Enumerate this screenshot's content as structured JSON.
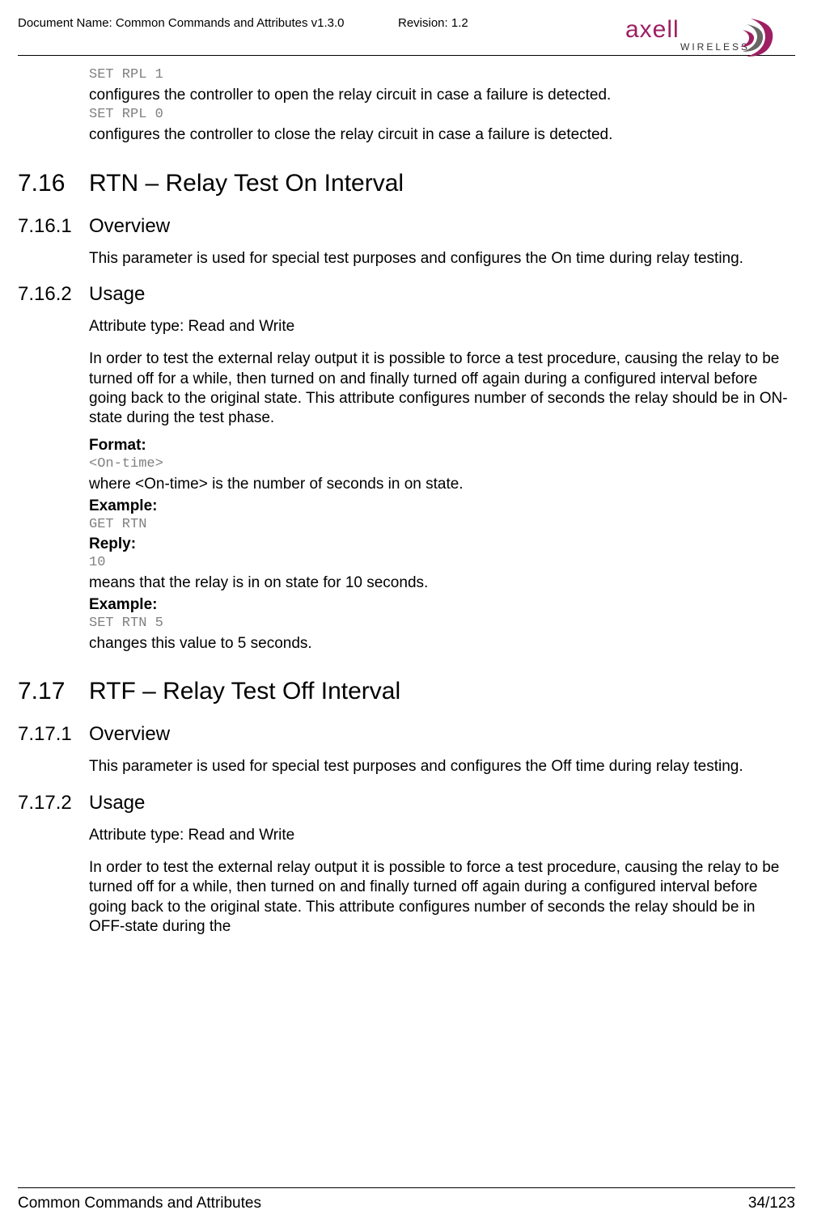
{
  "header": {
    "doc_name_label": "Document Name: Common Commands and Attributes v1.3.0",
    "revision_label": "Revision: 1.2",
    "logo_brand": "axell",
    "logo_sub": "WIRELESS"
  },
  "intro": {
    "code1": "SET RPL 1",
    "text1": "configures the controller to open the relay circuit in case a failure is detected.",
    "code2": "SET RPL 0",
    "text2": "configures the controller to close the relay circuit in case a failure is detected."
  },
  "s716": {
    "num": "7.16",
    "title": "RTN – Relay Test On Interval",
    "s1": {
      "num": "7.16.1",
      "title": "Overview",
      "p1": "This parameter is used for special test purposes and configures the On time during relay testing."
    },
    "s2": {
      "num": "7.16.2",
      "title": "Usage",
      "attr_type": "Attribute type: Read and Write",
      "p1": "In order to test the external relay output it is possible to force a test procedure, causing the relay to be turned off for a while, then turned on and finally turned off again during a configured interval before going back to the original state. This attribute configures number of seconds the relay should be in ON-state during the test phase.",
      "format_label": "Format:",
      "format_code": "<On-time>",
      "format_desc": "where <On-time> is the number of seconds in on state.",
      "example1_label": "Example:",
      "example1_code": "GET RTN",
      "reply_label": "Reply:",
      "reply_code": "10",
      "reply_desc": "means that the relay is in on state for 10 seconds.",
      "example2_label": "Example:",
      "example2_code": "SET RTN 5",
      "example2_desc": "changes this value to 5 seconds."
    }
  },
  "s717": {
    "num": "7.17",
    "title": "RTF – Relay Test Off Interval",
    "s1": {
      "num": "7.17.1",
      "title": "Overview",
      "p1": "This parameter is used for special test purposes and configures the Off time during relay testing."
    },
    "s2": {
      "num": "7.17.2",
      "title": "Usage",
      "attr_type": "Attribute type: Read and Write",
      "p1": "In order to test the external relay output it is possible to force a test procedure, causing the relay to be turned off for a while, then turned on and finally turned off again during a configured interval before going back to the original state. This attribute configures number of seconds the relay should be in OFF-state during the"
    }
  },
  "footer": {
    "title": "Common Commands and Attributes",
    "page": "34/123"
  }
}
